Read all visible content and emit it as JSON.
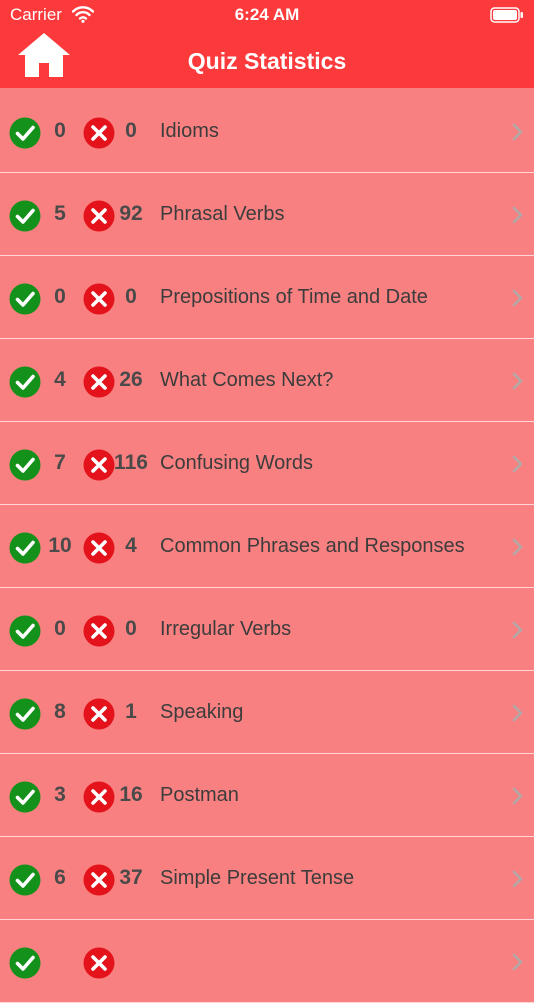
{
  "status": {
    "carrier": "Carrier",
    "time": "6:24 AM"
  },
  "header": {
    "title": "Quiz Statistics"
  },
  "rows": [
    {
      "correct": "0",
      "wrong": "0",
      "name": "Idioms"
    },
    {
      "correct": "5",
      "wrong": "92",
      "name": "Phrasal Verbs"
    },
    {
      "correct": "0",
      "wrong": "0",
      "name": "Prepositions of Time and Date"
    },
    {
      "correct": "4",
      "wrong": "26",
      "name": "What Comes Next?"
    },
    {
      "correct": "7",
      "wrong": "116",
      "name": "Confusing Words"
    },
    {
      "correct": "10",
      "wrong": "4",
      "name": "Common Phrases and Responses"
    },
    {
      "correct": "0",
      "wrong": "0",
      "name": "Irregular Verbs"
    },
    {
      "correct": "8",
      "wrong": "1",
      "name": "Speaking"
    },
    {
      "correct": "3",
      "wrong": "16",
      "name": "Postman"
    },
    {
      "correct": "6",
      "wrong": "37",
      "name": "Simple Present Tense"
    },
    {
      "correct": "",
      "wrong": "",
      "name": ""
    }
  ],
  "colors": {
    "header": "#fc3a3b",
    "row": "#f98080",
    "check": "#14911a",
    "cross": "#e3121b"
  },
  "icons": {
    "home": "home-icon",
    "correct": "check-circle-icon",
    "wrong": "x-circle-icon",
    "chevron": "chevron-right-icon",
    "wifi": "wifi-icon",
    "battery": "battery-icon"
  }
}
